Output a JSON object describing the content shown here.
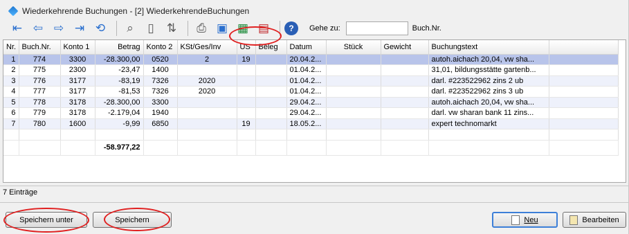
{
  "window": {
    "title": "Wiederkehrende Buchungen  -  [2] WiederkehrendeBuchungen"
  },
  "toolbar": {
    "goto_label": "Gehe zu:",
    "goto_value": "",
    "buch_nr_label": "Buch.Nr."
  },
  "table": {
    "headers": [
      "Nr.",
      "Buch.Nr.",
      "Konto 1",
      "Betrag",
      "Konto 2",
      "KSt/Ges/Inv",
      "US",
      "Beleg",
      "Datum",
      "Stück",
      "Gewicht",
      "Buchungstext"
    ],
    "rows": [
      {
        "nr": "1",
        "buchnr": "774",
        "konto1": "3300",
        "betrag": "-28.300,00",
        "konto2": "0520",
        "kst": "2",
        "us": "19",
        "beleg": "",
        "datum": "20.04.2...",
        "stueck": "",
        "gewicht": "",
        "text": "autoh.aichach 20,04, vw sha..."
      },
      {
        "nr": "2",
        "buchnr": "775",
        "konto1": "2300",
        "betrag": "-23,47",
        "konto2": "1400",
        "kst": "",
        "us": "",
        "beleg": "",
        "datum": "01.04.2...",
        "stueck": "",
        "gewicht": "",
        "text": "31,01, bildungsstätte gartenb..."
      },
      {
        "nr": "3",
        "buchnr": "776",
        "konto1": "3177",
        "betrag": "-83,19",
        "konto2": "7326",
        "kst": "2020",
        "us": "",
        "beleg": "",
        "datum": "01.04.2...",
        "stueck": "",
        "gewicht": "",
        "text": "darl. #223522962 zins 2 ub"
      },
      {
        "nr": "4",
        "buchnr": "777",
        "konto1": "3177",
        "betrag": "-81,53",
        "konto2": "7326",
        "kst": "2020",
        "us": "",
        "beleg": "",
        "datum": "01.04.2...",
        "stueck": "",
        "gewicht": "",
        "text": "darl. #223522962 zins 3 ub"
      },
      {
        "nr": "5",
        "buchnr": "778",
        "konto1": "3178",
        "betrag": "-28.300,00",
        "konto2": "3300",
        "kst": "",
        "us": "",
        "beleg": "",
        "datum": "29.04.2...",
        "stueck": "",
        "gewicht": "",
        "text": "autoh.aichach 20,04, vw sha..."
      },
      {
        "nr": "6",
        "buchnr": "779",
        "konto1": "3178",
        "betrag": "-2.179,04",
        "konto2": "1940",
        "kst": "",
        "us": "",
        "beleg": "",
        "datum": "29.04.2...",
        "stueck": "",
        "gewicht": "",
        "text": "darl. vw sharan bank 11 zins..."
      },
      {
        "nr": "7",
        "buchnr": "780",
        "konto1": "1600",
        "betrag": "-9,99",
        "konto2": "6850",
        "kst": "",
        "us": "19",
        "beleg": "",
        "datum": "18.05.2...",
        "stueck": "",
        "gewicht": "",
        "text": "expert technomarkt"
      }
    ],
    "total": "-58.977,22"
  },
  "status": {
    "count_text": "7 Einträge"
  },
  "buttons": {
    "save_as": "Speichern unter",
    "save": "Speichern",
    "new": "Neu",
    "edit": "Bearbeiten"
  },
  "icons": [
    "first-icon",
    "prev-icon",
    "next-icon",
    "last-icon",
    "refresh-icon",
    "search-icon",
    "find-doc-icon",
    "sort-icon",
    "print-icon",
    "save-icon",
    "excel-icon",
    "pdf-icon",
    "help-icon"
  ]
}
